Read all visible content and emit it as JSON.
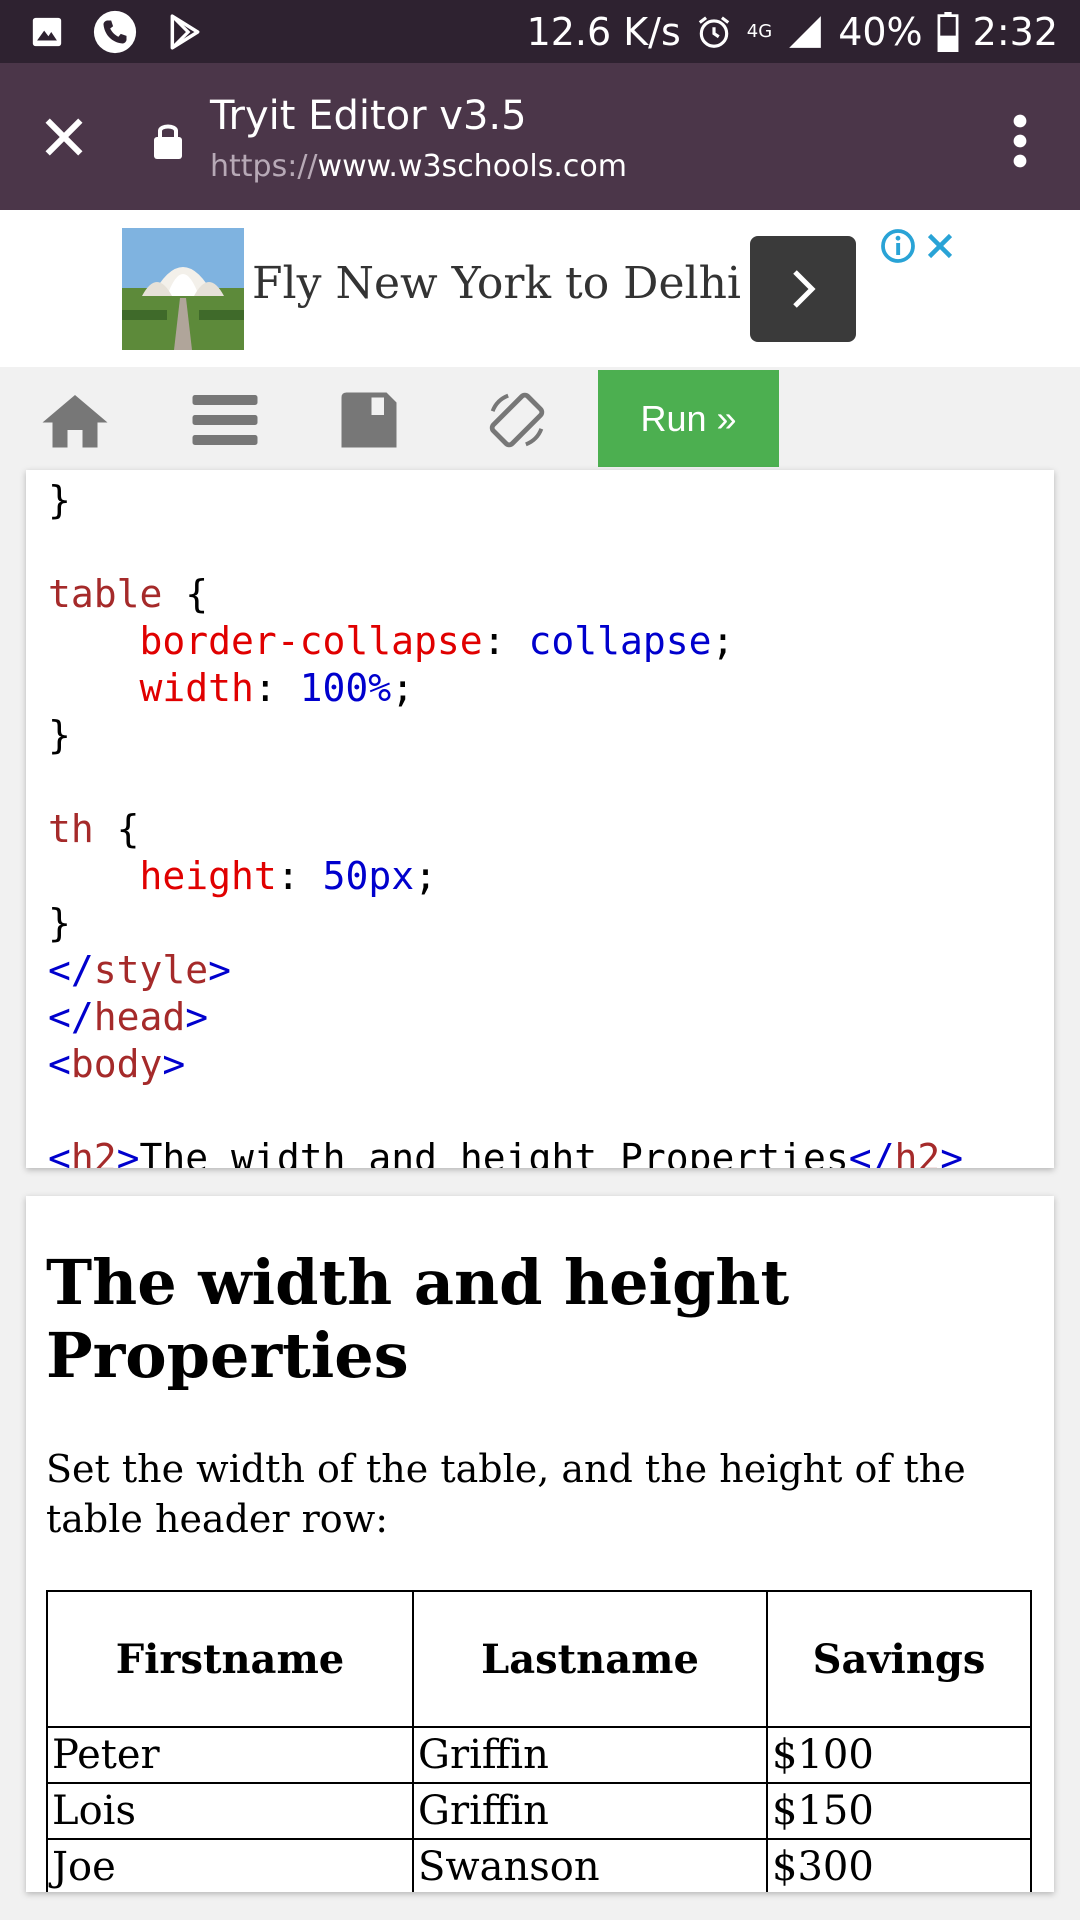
{
  "status_bar": {
    "net_speed": "12.6 K/s",
    "network": "4G",
    "battery": "40%",
    "time": "2:32"
  },
  "browser": {
    "title": "Tryit Editor v3.5",
    "url_scheme": "https://",
    "url_host": "www.w3schools.com"
  },
  "ad": {
    "text": "Fly New York to Delhi"
  },
  "toolbar": {
    "run_label": "Run »"
  },
  "code": {
    "lines": [
      [
        {
          "t": "    ",
          "c": ""
        },
        {
          "t": "             .",
          "c": ""
        }
      ],
      [
        {
          "t": "}",
          "c": ""
        }
      ],
      [],
      [
        {
          "t": "table",
          "c": "sel"
        },
        {
          "t": " {",
          "c": ""
        }
      ],
      [
        {
          "t": "    ",
          "c": ""
        },
        {
          "t": "border-collapse",
          "c": "prop"
        },
        {
          "t": ": ",
          "c": ""
        },
        {
          "t": "collapse",
          "c": "val"
        },
        {
          "t": ";",
          "c": ""
        }
      ],
      [
        {
          "t": "    ",
          "c": ""
        },
        {
          "t": "width",
          "c": "prop"
        },
        {
          "t": ": ",
          "c": ""
        },
        {
          "t": "100%",
          "c": "val"
        },
        {
          "t": ";",
          "c": ""
        }
      ],
      [
        {
          "t": "}",
          "c": ""
        }
      ],
      [],
      [
        {
          "t": "th",
          "c": "sel"
        },
        {
          "t": " {",
          "c": ""
        }
      ],
      [
        {
          "t": "    ",
          "c": ""
        },
        {
          "t": "height",
          "c": "prop"
        },
        {
          "t": ": ",
          "c": ""
        },
        {
          "t": "50px",
          "c": "val"
        },
        {
          "t": ";",
          "c": ""
        }
      ],
      [
        {
          "t": "}",
          "c": ""
        }
      ],
      [
        {
          "t": "</",
          "c": "tagb"
        },
        {
          "t": "style",
          "c": "tagn"
        },
        {
          "t": ">",
          "c": "tagb"
        }
      ],
      [
        {
          "t": "</",
          "c": "tagb"
        },
        {
          "t": "head",
          "c": "tagn"
        },
        {
          "t": ">",
          "c": "tagb"
        }
      ],
      [
        {
          "t": "<",
          "c": "tagb"
        },
        {
          "t": "body",
          "c": "tagn"
        },
        {
          "t": ">",
          "c": "tagb"
        }
      ],
      [],
      [
        {
          "t": "<",
          "c": "tagb"
        },
        {
          "t": "h2",
          "c": "tagn"
        },
        {
          "t": ">",
          "c": "tagb"
        },
        {
          "t": "The width and height Properties",
          "c": ""
        },
        {
          "t": "</",
          "c": "tagb"
        },
        {
          "t": "h2",
          "c": "tagn"
        },
        {
          "t": ">",
          "c": "tagb"
        }
      ]
    ]
  },
  "result": {
    "title": "The width and height Properties",
    "description": "Set the width of the table, and the height of the table header row:",
    "table": {
      "headers": [
        "Firstname",
        "Lastname",
        "Savings"
      ],
      "rows": [
        [
          "Peter",
          "Griffin",
          "$100"
        ],
        [
          "Lois",
          "Griffin",
          "$150"
        ],
        [
          "Joe",
          "Swanson",
          "$300"
        ]
      ]
    }
  },
  "colors": {
    "status_bar_bg": "#2e2230",
    "browser_bar_bg": "#4b3649",
    "run_button_bg": "#4caf50",
    "code_selector": "#a52a2a",
    "code_property": "#e00000",
    "code_value": "#0000cd"
  }
}
